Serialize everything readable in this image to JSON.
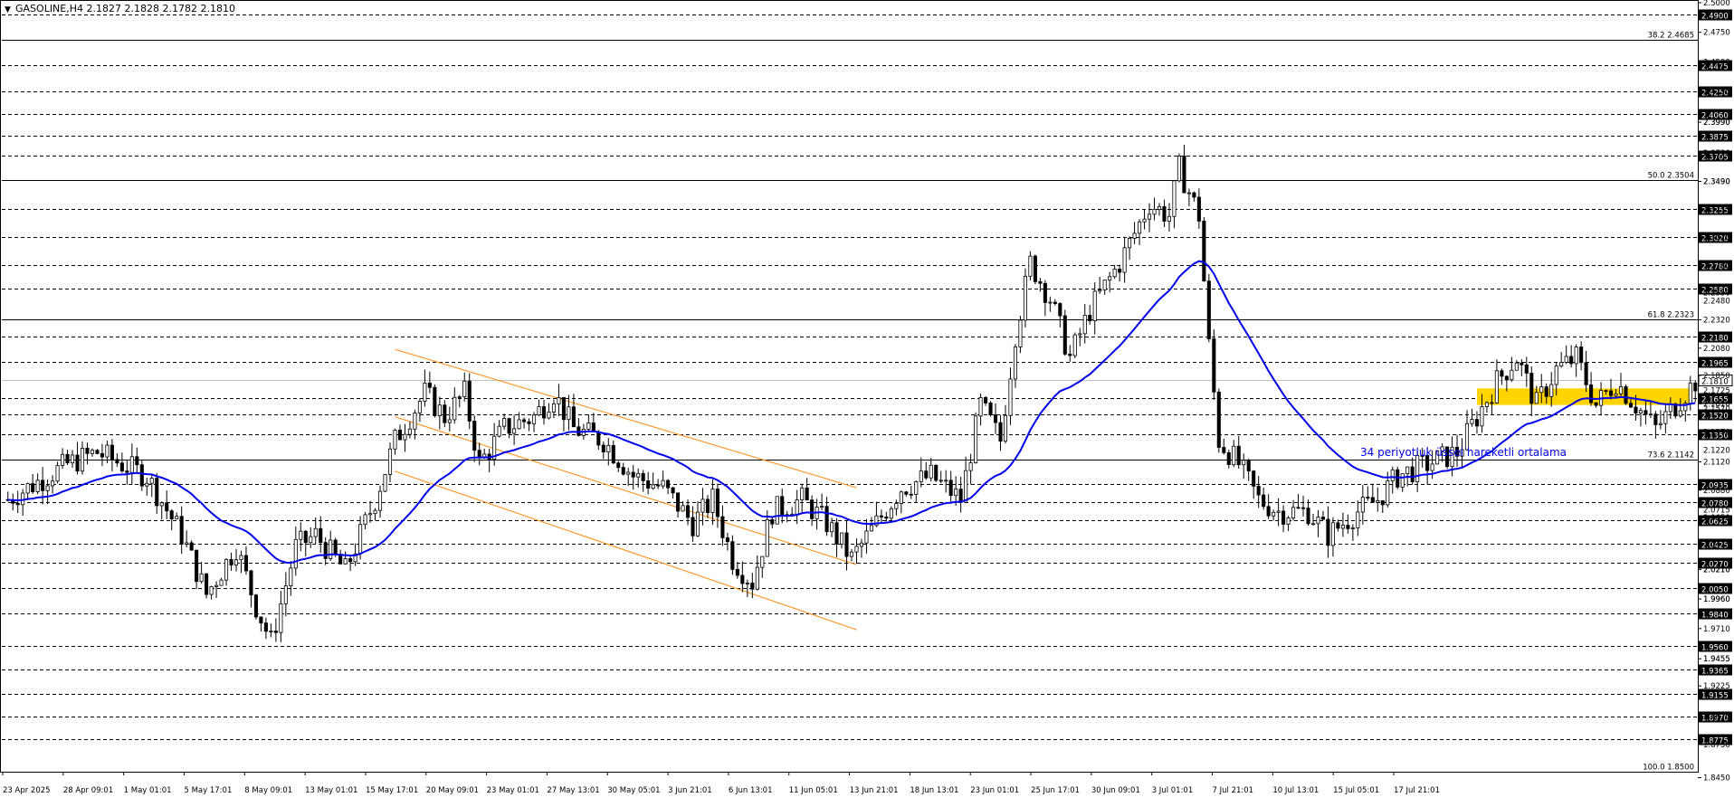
{
  "header": {
    "symbol_info": "GASOLINE,H4  2.1827 2.1828 2.1782 2.1810",
    "menu_icon": "triangle-down-icon"
  },
  "chart_data": {
    "type": "candlestick",
    "symbol": "GASOLINE",
    "timeframe": "H4",
    "ohlc_header": {
      "open": 2.1827,
      "high": 2.1828,
      "low": 2.1782,
      "close": 2.181
    },
    "ylim": [
      1.85,
      2.5
    ],
    "x_tick_labels": [
      "23 Apr 2025",
      "28 Apr 09:01",
      "1 May 01:01",
      "5 May 17:01",
      "8 May 09:01",
      "13 May 01:01",
      "15 May 17:01",
      "20 May 09:01",
      "23 May 01:01",
      "27 May 13:01",
      "30 May 05:01",
      "3 Jun 21:01",
      "6 Jun 13:01",
      "11 Jun 05:01",
      "13 Jun 21:01",
      "18 Jun 13:01",
      "23 Jun 01:01",
      "25 Jun 17:01",
      "30 Jun 09:01",
      "3 Jul 01:01",
      "7 Jul 21:01",
      "10 Jul 13:01",
      "15 Jul 05:01",
      "17 Jul 21:01"
    ],
    "y_tick_labels": [
      "2.5000",
      "2.4750",
      "2.4500",
      "2.4250",
      "2.3990",
      "2.3730",
      "2.3490",
      "2.3255",
      "2.3020",
      "2.2780",
      "2.2550",
      "2.2320",
      "2.2080",
      "2.1850",
      "2.1610",
      "2.1370",
      "2.1120",
      "2.0880",
      "2.0650",
      "2.0425",
      "2.0210",
      "1.9960",
      "1.9710",
      "1.9455",
      "1.9225",
      "1.8970",
      "1.8730",
      "1.8450"
    ],
    "dashed_levels": [
      {
        "value": 2.49,
        "label": "2.4900"
      },
      {
        "value": 2.4475,
        "label": "2.4475"
      },
      {
        "value": 2.425,
        "label": "2.4250"
      },
      {
        "value": 2.406,
        "label": "2.4060"
      },
      {
        "value": 2.3875,
        "label": "2.3875"
      },
      {
        "value": 2.3705,
        "label": "2.3705"
      },
      {
        "value": 2.3255,
        "label": "2.3255"
      },
      {
        "value": 2.302,
        "label": "2.3020"
      },
      {
        "value": 2.278,
        "label": "2.2780"
      },
      {
        "value": 2.258,
        "label": "2.2580"
      },
      {
        "value": 2.218,
        "label": "2.2180"
      },
      {
        "value": 2.1965,
        "label": "2.1965"
      },
      {
        "value": 2.1655,
        "label": "2.1655"
      },
      {
        "value": 2.152,
        "label": "2.1520"
      },
      {
        "value": 2.135,
        "label": "2.1350"
      },
      {
        "value": 2.0935,
        "label": "2.0935"
      },
      {
        "value": 2.078,
        "label": "2.0780"
      },
      {
        "value": 2.0625,
        "label": "2.0625"
      },
      {
        "value": 2.0425,
        "label": "2.0425"
      },
      {
        "value": 2.027,
        "label": "2.0270"
      },
      {
        "value": 2.005,
        "label": "2.0050"
      },
      {
        "value": 1.984,
        "label": "1.9840"
      },
      {
        "value": 1.956,
        "label": "1.9560"
      },
      {
        "value": 1.9365,
        "label": "1.9365"
      },
      {
        "value": 1.9155,
        "label": "1.9155"
      },
      {
        "value": 1.897,
        "label": "1.8970"
      },
      {
        "value": 1.8775,
        "label": "1.8775"
      }
    ],
    "fib_levels": [
      {
        "value": 2.4685,
        "label": "38.2 2.4685"
      },
      {
        "value": 2.3504,
        "label": "50.0 2.3504"
      },
      {
        "value": 2.2323,
        "label": "61.8 2.2323"
      },
      {
        "value": 2.1142,
        "label": "73.6 2.1142"
      },
      {
        "value": 1.85,
        "label": "100.0 1.8500"
      }
    ],
    "price_line": {
      "value": 2.181,
      "label": "2.1810"
    },
    "minor_axis_labels": [
      {
        "value": 2.1725,
        "label": "2.1725"
      },
      {
        "value": 2.157,
        "label": "2.1570"
      },
      {
        "value": 2.0715,
        "label": "2.0715"
      },
      {
        "value": 2.021,
        "label": "2.0210"
      },
      {
        "value": 1.996,
        "label": "1.9960"
      },
      {
        "value": 1.9455,
        "label": "1.9455"
      },
      {
        "value": 2.399,
        "label": "2.3990"
      },
      {
        "value": 2.349,
        "label": "2.3490"
      },
      {
        "value": 2.248,
        "label": "2.2480"
      },
      {
        "value": 2.122,
        "label": "2.1220"
      }
    ],
    "ema": {
      "period": 34,
      "annotation": "34 periyotluk üssel hareketli ortalama",
      "color": "#0000ee"
    },
    "channel_color": "#ff9a2e",
    "zone": {
      "low": 2.16,
      "high": 2.174,
      "color": "#ffd400"
    },
    "candle_colors": {
      "bull": "#ffffff",
      "bear": "#000000",
      "outline": "#000000"
    },
    "grid": false,
    "waypoints": [
      [
        0,
        2.08
      ],
      [
        12,
        2.11
      ],
      [
        18,
        2.12
      ],
      [
        28,
        2.1
      ],
      [
        35,
        2.05
      ],
      [
        40,
        2.0
      ],
      [
        46,
        2.04
      ],
      [
        50,
        1.99
      ],
      [
        53,
        1.96
      ],
      [
        58,
        2.04
      ],
      [
        62,
        2.05
      ],
      [
        68,
        2.02
      ],
      [
        74,
        2.08
      ],
      [
        78,
        2.13
      ],
      [
        84,
        2.17
      ],
      [
        88,
        2.15
      ],
      [
        92,
        2.17
      ],
      [
        95,
        2.11
      ],
      [
        100,
        2.14
      ],
      [
        106,
        2.15
      ],
      [
        110,
        2.17
      ],
      [
        114,
        2.14
      ],
      [
        120,
        2.13
      ],
      [
        126,
        2.1
      ],
      [
        132,
        2.09
      ],
      [
        138,
        2.06
      ],
      [
        142,
        2.08
      ],
      [
        146,
        2.03
      ],
      [
        150,
        2.01
      ],
      [
        154,
        2.07
      ],
      [
        160,
        2.08
      ],
      [
        165,
        2.06
      ],
      [
        170,
        2.03
      ],
      [
        175,
        2.06
      ],
      [
        180,
        2.09
      ],
      [
        186,
        2.1
      ],
      [
        192,
        2.08
      ],
      [
        196,
        2.16
      ],
      [
        200,
        2.13
      ],
      [
        203,
        2.22
      ],
      [
        206,
        2.28
      ],
      [
        210,
        2.25
      ],
      [
        214,
        2.2
      ],
      [
        218,
        2.24
      ],
      [
        224,
        2.28
      ],
      [
        230,
        2.33
      ],
      [
        234,
        2.32
      ],
      [
        236,
        2.36
      ],
      [
        240,
        2.32
      ],
      [
        242,
        2.21
      ],
      [
        244,
        2.13
      ],
      [
        248,
        2.11
      ],
      [
        252,
        2.08
      ],
      [
        256,
        2.07
      ],
      [
        262,
        2.07
      ],
      [
        266,
        2.05
      ],
      [
        272,
        2.07
      ],
      [
        276,
        2.08
      ],
      [
        280,
        2.1
      ],
      [
        286,
        2.11
      ],
      [
        292,
        2.12
      ],
      [
        296,
        2.15
      ],
      [
        300,
        2.18
      ],
      [
        304,
        2.2
      ],
      [
        308,
        2.16
      ],
      [
        312,
        2.19
      ],
      [
        316,
        2.2
      ],
      [
        320,
        2.16
      ],
      [
        324,
        2.18
      ],
      [
        328,
        2.16
      ],
      [
        332,
        2.14
      ],
      [
        336,
        2.16
      ],
      [
        340,
        2.18
      ]
    ],
    "channel": {
      "upper": {
        "start_index": 78,
        "start": 2.207,
        "end_index": 171,
        "end": 2.09
      },
      "lower": {
        "start_index": 78,
        "start": 2.104,
        "end_index": 171,
        "end": 1.97
      },
      "mid_segment": {
        "start_index": 78,
        "start": 2.15,
        "end_index": 171,
        "end": 2.025
      }
    }
  }
}
